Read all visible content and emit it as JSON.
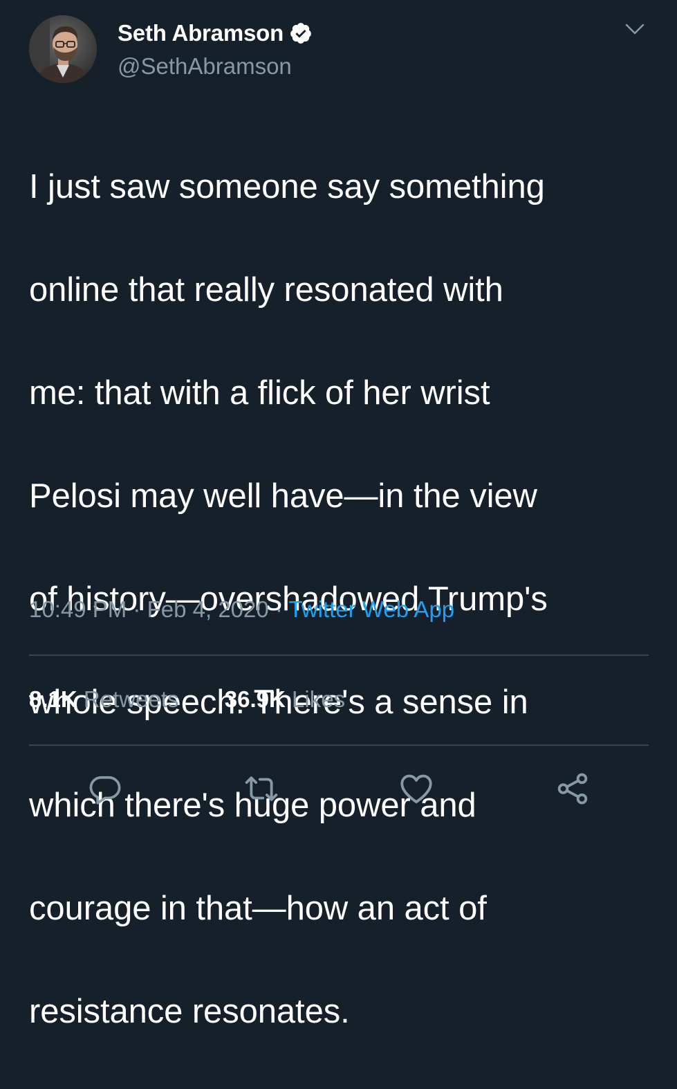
{
  "tweet": {
    "author": {
      "display_name": "Seth Abramson",
      "handle": "@SethAbramson",
      "verified": true,
      "avatar": "author-photo"
    },
    "text_lines": [
      "I just saw someone say something",
      "online that really resonated with",
      "me: that with a flick of her wrist",
      "Pelosi may well have—in the view",
      "of history—overshadowed Trump's",
      "whole speech. There's a sense in",
      "which there's huge power and",
      "courage in that—how an act of",
      "resistance resonates."
    ],
    "time": "10:49 PM",
    "date": "Feb 4, 2020",
    "separator": "·",
    "source": "Twitter Web App",
    "stats": {
      "retweets_count": "8.1K",
      "retweets_label": "Retweets",
      "likes_count": "36.9K",
      "likes_label": "Likes"
    }
  },
  "icons": {
    "menu": "chevron-down-icon",
    "reply": "reply-icon",
    "retweet": "retweet-icon",
    "like": "heart-icon",
    "share": "share-icon",
    "verified": "verified-badge-icon"
  },
  "colors": {
    "background": "#15202b",
    "text_primary": "#ffffff",
    "text_secondary": "#8899a6",
    "accent": "#1da1f2",
    "divider": "#38444d"
  }
}
